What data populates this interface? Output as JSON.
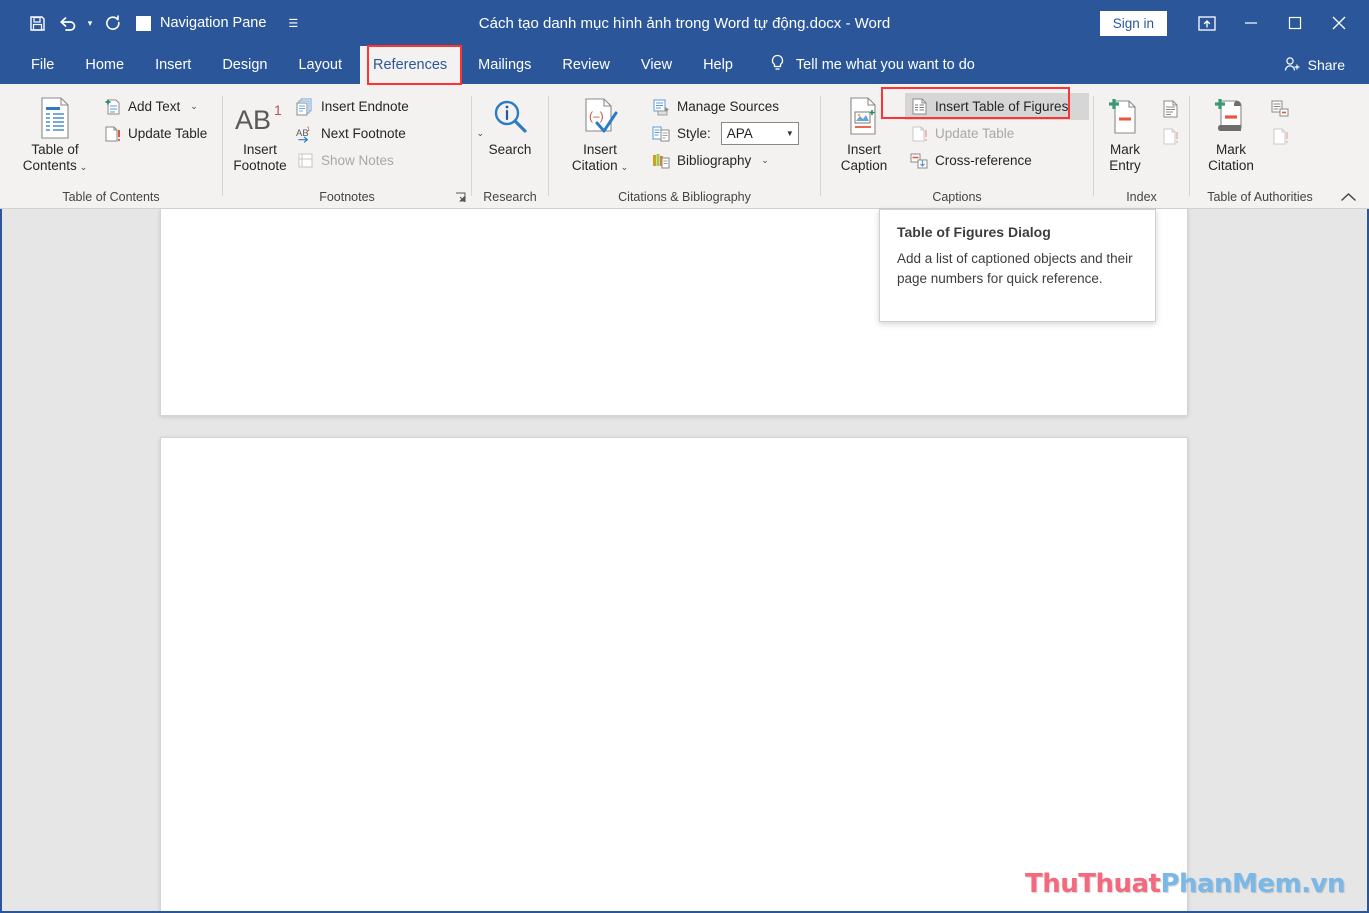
{
  "titlebar": {
    "document_title": "Cách tạo danh mục hình ảnh trong Word tự động.docx  -  Word",
    "quick_access": [
      {
        "name": "save-icon",
        "label": "Save"
      },
      {
        "name": "undo-icon",
        "label": "Undo"
      },
      {
        "name": "redo-icon",
        "label": "Redo"
      }
    ],
    "navigation_pane_label": "Navigation Pane",
    "customize_qat_label": "⌄",
    "sign_in_label": "Sign in",
    "ribbon_display_options_label": "Ribbon Display Options",
    "minimize_label": "—",
    "restore_label": "❐",
    "close_label": "✕"
  },
  "tabs": {
    "items": [
      {
        "label": "File"
      },
      {
        "label": "Home"
      },
      {
        "label": "Insert"
      },
      {
        "label": "Design"
      },
      {
        "label": "Layout"
      },
      {
        "label": "References"
      },
      {
        "label": "Mailings"
      },
      {
        "label": "Review"
      },
      {
        "label": "View"
      },
      {
        "label": "Help"
      }
    ],
    "active": "References",
    "tell_me_label": "Tell me what you want to do",
    "share_label": "Share"
  },
  "ribbon": {
    "collapse_label": "⌃",
    "groups": [
      {
        "label": "Table of Contents",
        "big_button": {
          "line1": "Table of",
          "line2": "Contents",
          "has_chevron": true
        },
        "small_buttons": [
          {
            "label": "Add Text",
            "has_chevron": true,
            "disabled": false
          },
          {
            "label": "Update Table",
            "has_chevron": false,
            "disabled": false
          }
        ]
      },
      {
        "label": "Footnotes",
        "big_button": {
          "line1": "Insert",
          "line2": "Footnote",
          "has_chevron": false,
          "glyph": "AB",
          "sup": "1"
        },
        "small_buttons": [
          {
            "label": "Insert Endnote",
            "has_chevron": false,
            "disabled": false
          },
          {
            "label": "Next Footnote",
            "has_chevron": true,
            "disabled": false
          },
          {
            "label": "Show Notes",
            "has_chevron": false,
            "disabled": true
          }
        ],
        "dialog_launcher": true
      },
      {
        "label": "Research",
        "big_button": {
          "line1": "Search",
          "line2": "",
          "has_chevron": false
        }
      },
      {
        "label": "Citations & Bibliography",
        "big_button": {
          "line1": "Insert",
          "line2": "Citation",
          "has_chevron": true
        },
        "small_buttons": [
          {
            "label": "Manage Sources",
            "has_chevron": false,
            "disabled": false
          },
          {
            "label": "Style:",
            "has_chevron": false,
            "disabled": false,
            "style_value": "APA"
          },
          {
            "label": "Bibliography",
            "has_chevron": true,
            "disabled": false
          }
        ]
      },
      {
        "label": "Captions",
        "big_button": {
          "line1": "Insert",
          "line2": "Caption",
          "has_chevron": false
        },
        "small_buttons": [
          {
            "label": "Insert Table of Figures",
            "has_chevron": false,
            "disabled": false,
            "highlighted": true
          },
          {
            "label": "Update Table",
            "has_chevron": false,
            "disabled": true
          },
          {
            "label": "Cross-reference",
            "has_chevron": false,
            "disabled": false
          }
        ]
      },
      {
        "label": "Index",
        "big_button": {
          "line1": "Mark",
          "line2": "Entry",
          "has_chevron": false
        },
        "icon_only": [
          "update-index-icon",
          "insert-index-icon"
        ]
      },
      {
        "label": "Table of Authorities",
        "big_button": {
          "line1": "Mark",
          "line2": "Citation",
          "has_chevron": false
        },
        "icon_only": [
          "insert-table-of-authorities-icon",
          "update-table-icon"
        ]
      }
    ]
  },
  "tooltip": {
    "title": "Table of Figures Dialog",
    "body": "Add a list of captioned objects and their page numbers for quick reference."
  },
  "watermark": {
    "part1": "ThuThuat",
    "part2": "PhanMem.vn"
  },
  "colors": {
    "titlebar_blue": "#2b579a",
    "ribbon_bg": "#f3f2f1",
    "highlight_red": "#ff3333",
    "document_bg": "#e6e6e6",
    "watermark_red": "#f5697f",
    "watermark_blue": "#7ab8e8"
  }
}
